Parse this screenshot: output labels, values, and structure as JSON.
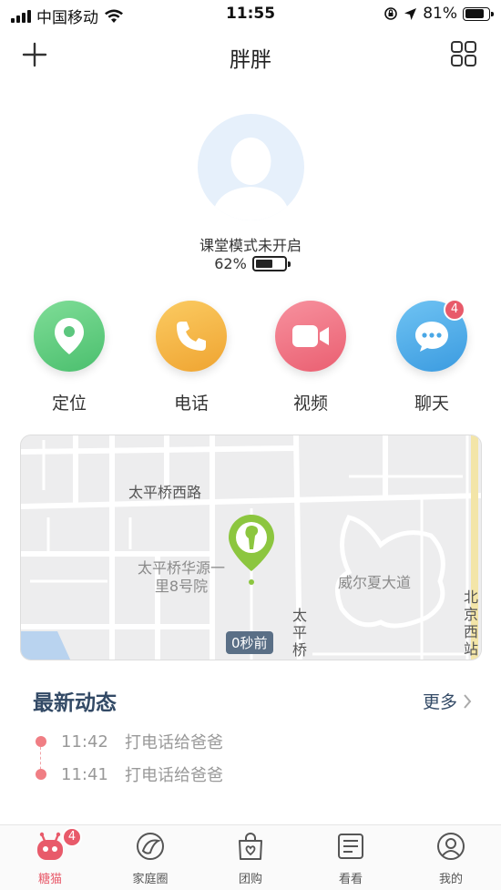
{
  "status_bar": {
    "carrier": "中国移动",
    "time": "11:55",
    "battery": "81%",
    "battery_level": 0.81
  },
  "header": {
    "title": "胖胖"
  },
  "profile": {
    "mode_text": "课堂模式未开启",
    "battery_text": "62%",
    "battery_level": 0.62
  },
  "actions": [
    {
      "label": "定位",
      "icon": "location-pin-icon",
      "color": "#5cc77e"
    },
    {
      "label": "电话",
      "icon": "phone-icon",
      "color": "#f2b13f"
    },
    {
      "label": "视频",
      "icon": "video-camera-icon",
      "color": "#ef6f7f"
    },
    {
      "label": "聊天",
      "icon": "chat-bubble-icon",
      "color": "#4aa7e6",
      "badge": "4"
    }
  ],
  "map": {
    "labels": {
      "road1": "太平桥西路",
      "building": "太平桥华源一里8号院",
      "avenue": "威尔夏大道",
      "road2": "太平桥",
      "station": "北京西站"
    },
    "time_tag": "0秒前",
    "pin_color": "#8cc63f"
  },
  "feed": {
    "title": "最新动态",
    "more": "更多",
    "items": [
      {
        "time": "11:42",
        "text": "打电话给爸爸"
      },
      {
        "time": "11:41",
        "text": "打电话给爸爸"
      }
    ]
  },
  "tabbar": {
    "tabs": [
      {
        "label": "糖猫",
        "icon": "robot-cat-icon",
        "badge": "4",
        "active": true
      },
      {
        "label": "家庭圈",
        "icon": "family-circle-icon"
      },
      {
        "label": "团购",
        "icon": "shopping-bag-icon"
      },
      {
        "label": "看看",
        "icon": "news-icon"
      },
      {
        "label": "我的",
        "icon": "profile-icon"
      }
    ]
  }
}
